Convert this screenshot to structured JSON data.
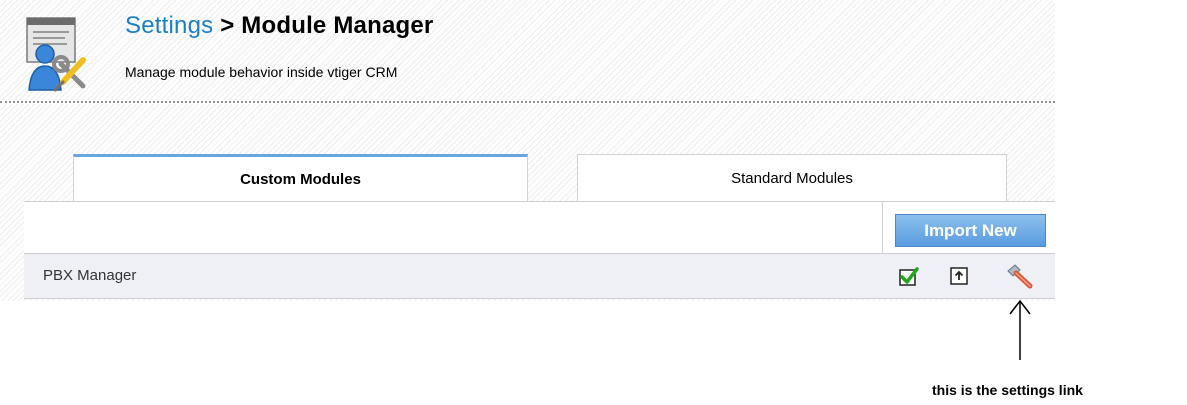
{
  "header": {
    "settings_link": "Settings",
    "separator": ">",
    "current_page": "Module Manager",
    "subtitle": "Manage module behavior inside vtiger CRM"
  },
  "tabs": [
    {
      "label": "Custom Modules",
      "active": true
    },
    {
      "label": "Standard Modules",
      "active": false
    }
  ],
  "toolbar": {
    "import_label": "Import New"
  },
  "modules": [
    {
      "name": "PBX Manager",
      "actions": [
        "check-icon",
        "upload-icon",
        "settings-tool-icon"
      ]
    }
  ],
  "annotation": {
    "text": "this is the settings link"
  },
  "colors": {
    "link": "#1a7fc8",
    "tab_active_border": "#6aa6de",
    "button_top": "#8cc0ee",
    "button_bottom": "#5a9be0",
    "row_bg": "#eef0f6"
  }
}
